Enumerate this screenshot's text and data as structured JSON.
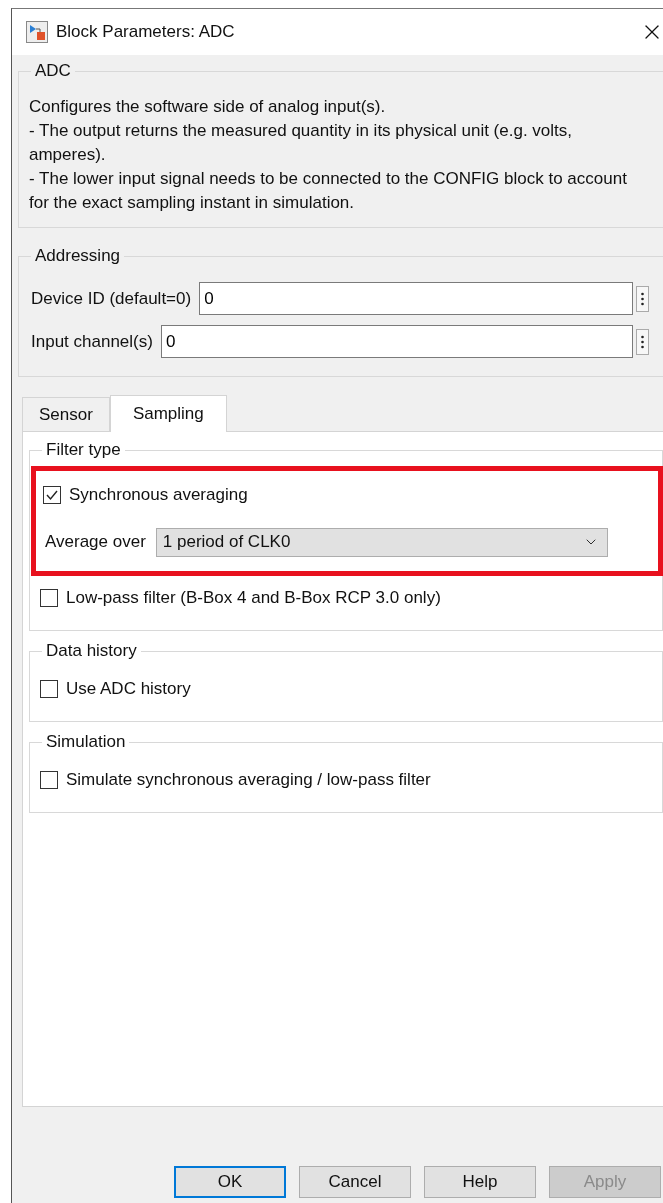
{
  "window": {
    "title": "Block Parameters: ADC"
  },
  "description": {
    "title": "ADC",
    "paragraphs": [
      "Configures the software side of analog input(s).",
      "- The output returns the measured quantity in its physical unit (e.g. volts, amperes).",
      "- The lower input signal needs to be connected to the CONFIG block to account for the exact sampling instant in simulation."
    ]
  },
  "addressing": {
    "title": "Addressing",
    "fields": [
      {
        "label": "Device ID (default=0)",
        "value": "0"
      },
      {
        "label": "Input channel(s)",
        "value": "0"
      }
    ]
  },
  "tabs": [
    {
      "label": "Sensor",
      "selected": false
    },
    {
      "label": "Sampling",
      "selected": true
    }
  ],
  "groups": [
    {
      "title": "Filter type",
      "items": [
        {
          "kind": "checkbox",
          "label": "Synchronous averaging",
          "checked": true,
          "highlighted": true
        },
        {
          "kind": "dropdown",
          "label": "Average over",
          "value": "1 period of CLK0",
          "highlighted": true
        },
        {
          "kind": "checkbox",
          "label": "Low-pass filter (B-Box 4 and B-Box RCP 3.0 only)",
          "checked": false,
          "highlighted": false
        }
      ]
    },
    {
      "title": "Data history",
      "items": [
        {
          "kind": "checkbox",
          "label": "Use ADC history",
          "checked": false,
          "highlighted": false
        }
      ]
    },
    {
      "title": "Simulation",
      "items": [
        {
          "kind": "checkbox",
          "label": "Simulate synchronous averaging / low-pass filter",
          "checked": false,
          "highlighted": false
        }
      ]
    }
  ],
  "buttons": [
    {
      "label": "OK",
      "default": true,
      "disabled": false
    },
    {
      "label": "Cancel",
      "default": false,
      "disabled": false
    },
    {
      "label": "Help",
      "default": false,
      "disabled": false
    },
    {
      "label": "Apply",
      "default": false,
      "disabled": true
    }
  ]
}
